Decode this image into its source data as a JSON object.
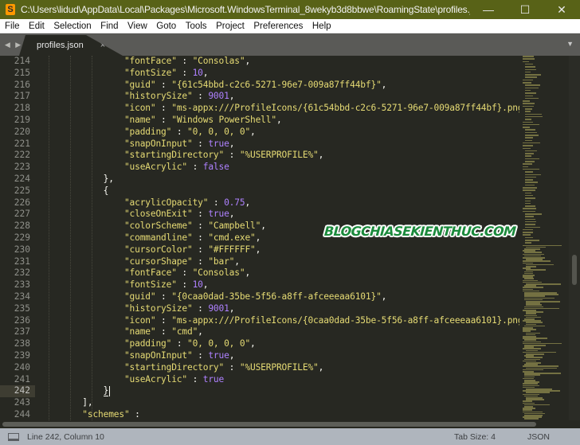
{
  "window": {
    "title": "C:\\Users\\lidud\\AppData\\Local\\Packages\\Microsoft.WindowsTerminal_8wekyb3d8bbwe\\RoamingState\\profiles.json - Sublime Text (U...",
    "app_icon": "S",
    "minimize": "—",
    "maximize": "☐",
    "close": "✕"
  },
  "menu": [
    "File",
    "Edit",
    "Selection",
    "Find",
    "View",
    "Goto",
    "Tools",
    "Project",
    "Preferences",
    "Help"
  ],
  "tabs": {
    "nav_arrows": "◀ ▶",
    "active": {
      "label": "profiles.json",
      "close": "×"
    },
    "dropdown": "▼"
  },
  "editor": {
    "active_line": 242,
    "lines": [
      {
        "n": "214",
        "indent": 4,
        "key": "\"fontFace\"",
        "val": "\"Consolas\"",
        "vt": "s",
        "tail": ","
      },
      {
        "n": "215",
        "indent": 4,
        "key": "\"fontSize\"",
        "val": "10",
        "vt": "n",
        "tail": ","
      },
      {
        "n": "216",
        "indent": 4,
        "key": "\"guid\"",
        "val": "\"{61c54bbd-c2c6-5271-96e7-009a87ff44bf}\"",
        "vt": "s",
        "tail": ","
      },
      {
        "n": "217",
        "indent": 4,
        "key": "\"historySize\"",
        "val": "9001",
        "vt": "n",
        "tail": ","
      },
      {
        "n": "218",
        "indent": 4,
        "key": "\"icon\"",
        "val": "\"ms-appx:///ProfileIcons/{61c54bbd-c2c6-5271-96e7-009a87ff44bf}.png",
        "vt": "s",
        "tail": ""
      },
      {
        "n": "219",
        "indent": 4,
        "key": "\"name\"",
        "val": "\"Windows PowerShell\"",
        "vt": "s",
        "tail": ","
      },
      {
        "n": "220",
        "indent": 4,
        "key": "\"padding\"",
        "val": "\"0, 0, 0, 0\"",
        "vt": "s",
        "tail": ","
      },
      {
        "n": "221",
        "indent": 4,
        "key": "\"snapOnInput\"",
        "val": "true",
        "vt": "n",
        "tail": ","
      },
      {
        "n": "222",
        "indent": 4,
        "key": "\"startingDirectory\"",
        "val": "\"%USERPROFILE%\"",
        "vt": "s",
        "tail": ","
      },
      {
        "n": "223",
        "indent": 4,
        "key": "\"useAcrylic\"",
        "val": "false",
        "vt": "n",
        "tail": ""
      },
      {
        "n": "224",
        "indent": 3,
        "raw": "},"
      },
      {
        "n": "225",
        "indent": 3,
        "raw": "{"
      },
      {
        "n": "226",
        "indent": 4,
        "key": "\"acrylicOpacity\"",
        "val": "0.75",
        "vt": "n",
        "tail": ","
      },
      {
        "n": "227",
        "indent": 4,
        "key": "\"closeOnExit\"",
        "val": "true",
        "vt": "n",
        "tail": ","
      },
      {
        "n": "228",
        "indent": 4,
        "key": "\"colorScheme\"",
        "val": "\"Campbell\"",
        "vt": "s",
        "tail": ","
      },
      {
        "n": "229",
        "indent": 4,
        "key": "\"commandline\"",
        "val": "\"cmd.exe\"",
        "vt": "s",
        "tail": ","
      },
      {
        "n": "230",
        "indent": 4,
        "key": "\"cursorColor\"",
        "val": "\"#FFFFFF\"",
        "vt": "s",
        "tail": ","
      },
      {
        "n": "231",
        "indent": 4,
        "key": "\"cursorShape\"",
        "val": "\"bar\"",
        "vt": "s",
        "tail": ","
      },
      {
        "n": "232",
        "indent": 4,
        "key": "\"fontFace\"",
        "val": "\"Consolas\"",
        "vt": "s",
        "tail": ","
      },
      {
        "n": "233",
        "indent": 4,
        "key": "\"fontSize\"",
        "val": "10",
        "vt": "n",
        "tail": ","
      },
      {
        "n": "234",
        "indent": 4,
        "key": "\"guid\"",
        "val": "\"{0caa0dad-35be-5f56-a8ff-afceeeaa6101}\"",
        "vt": "s",
        "tail": ","
      },
      {
        "n": "235",
        "indent": 4,
        "key": "\"historySize\"",
        "val": "9001",
        "vt": "n",
        "tail": ","
      },
      {
        "n": "236",
        "indent": 4,
        "key": "\"icon\"",
        "val": "\"ms-appx:///ProfileIcons/{0caa0dad-35be-5f56-a8ff-afceeeaa6101}.png",
        "vt": "s",
        "tail": ""
      },
      {
        "n": "237",
        "indent": 4,
        "key": "\"name\"",
        "val": "\"cmd\"",
        "vt": "s",
        "tail": ","
      },
      {
        "n": "238",
        "indent": 4,
        "key": "\"padding\"",
        "val": "\"0, 0, 0, 0\"",
        "vt": "s",
        "tail": ","
      },
      {
        "n": "239",
        "indent": 4,
        "key": "\"snapOnInput\"",
        "val": "true",
        "vt": "n",
        "tail": ","
      },
      {
        "n": "240",
        "indent": 4,
        "key": "\"startingDirectory\"",
        "val": "\"%USERPROFILE%\"",
        "vt": "s",
        "tail": ","
      },
      {
        "n": "241",
        "indent": 4,
        "key": "\"useAcrylic\"",
        "val": "true",
        "vt": "n",
        "tail": ""
      },
      {
        "n": "242",
        "indent": 3,
        "raw": "}",
        "cursor": true
      },
      {
        "n": "243",
        "indent": 2,
        "raw": "],"
      },
      {
        "n": "244",
        "indent": 2,
        "key": "\"schemes\"",
        "val": "",
        "vt": "s",
        "tail": ""
      }
    ]
  },
  "watermark": "BLOGCHIASEKIENTHUC.COM",
  "status": {
    "position": "Line 242, Column 10",
    "tab_size": "Tab Size: 4",
    "syntax": "JSON"
  }
}
